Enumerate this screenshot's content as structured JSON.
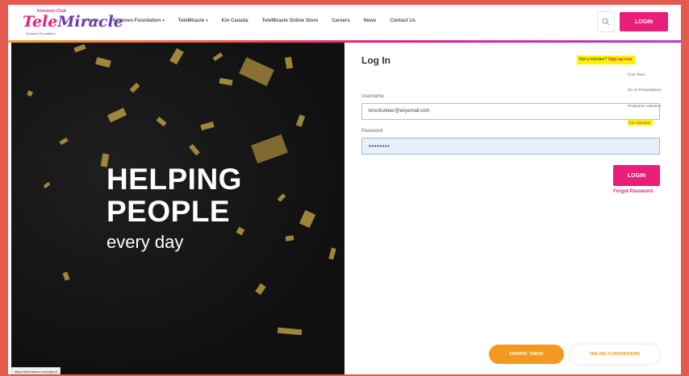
{
  "logo": {
    "top": "Kinsmen Club",
    "main_a": "Tele",
    "main_b": "Miracle",
    "sub": "Kinsmen Foundation"
  },
  "nav": [
    {
      "label": "Home",
      "caret": false
    },
    {
      "label": "Kinsmen Foundation",
      "caret": true
    },
    {
      "label": "TeleMiracle",
      "caret": true
    },
    {
      "label": "Kin Canada",
      "caret": false
    },
    {
      "label": "TeleMiracle Online Store",
      "caret": false
    },
    {
      "label": "Careers",
      "caret": false
    },
    {
      "label": "News",
      "caret": false
    },
    {
      "label": "Contact Us",
      "caret": false
    }
  ],
  "header": {
    "login_label": "LOGIN"
  },
  "hero": {
    "line1": "HELPING",
    "line2": "PEOPLE",
    "line3": "every day",
    "status_url": "https://telemiracle.com/login/#"
  },
  "login": {
    "title": "Log In",
    "not_member": "Not a member?",
    "signup": "Sign up now",
    "user_types": [
      "Core Team",
      "On Air Presentations",
      "Production Volunteer",
      "Kin Volunteer"
    ],
    "username_label": "Username",
    "username_value": "kinvolunteer@anyemail.com",
    "password_label": "Password",
    "password_value": "••••••••",
    "button": "LOGIN",
    "forgot": "Forgot Password"
  },
  "footer": {
    "donate": "DONATE TODAY",
    "fundraisers": "ONLINE FUNDRAISERS"
  },
  "colors": {
    "accent": "#e91e78",
    "orange": "#f39a1e",
    "highlight": "#fff200",
    "border": "#e35a4f"
  }
}
